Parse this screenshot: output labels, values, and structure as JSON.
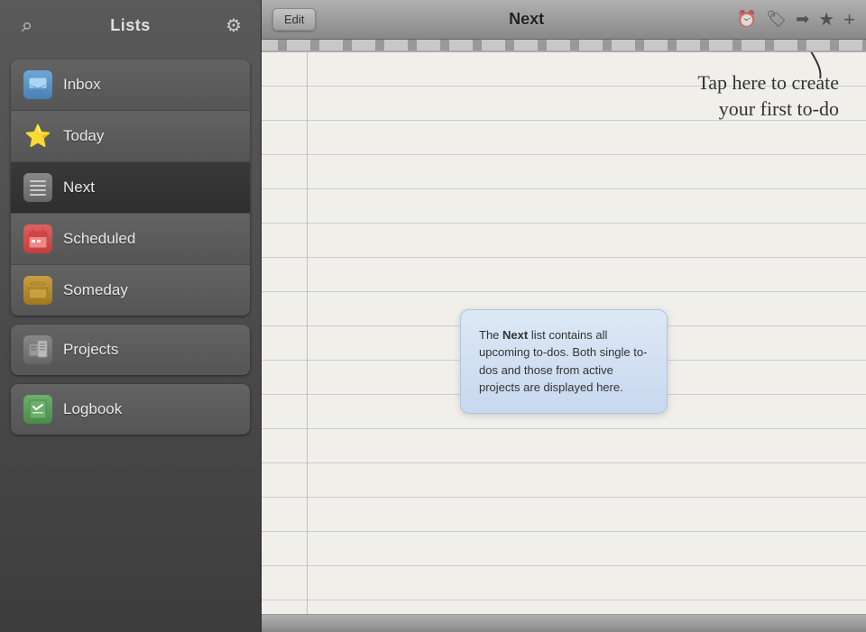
{
  "sidebar": {
    "title": "Lists",
    "search_icon": "⌕",
    "settings_icon": "⚙",
    "groups": [
      {
        "id": "main-list",
        "items": [
          {
            "id": "inbox",
            "label": "Inbox",
            "icon_type": "inbox",
            "icon_char": "📥",
            "active": false
          },
          {
            "id": "today",
            "label": "Today",
            "icon_type": "today",
            "icon_char": "⭐",
            "active": false
          },
          {
            "id": "next",
            "label": "Next",
            "icon_type": "next-icon",
            "icon_char": "≡",
            "active": true
          },
          {
            "id": "scheduled",
            "label": "Scheduled",
            "icon_type": "scheduled",
            "icon_char": "📅",
            "active": false
          },
          {
            "id": "someday",
            "label": "Someday",
            "icon_type": "someday",
            "icon_char": "📦",
            "active": false
          }
        ]
      }
    ],
    "single_groups": [
      {
        "id": "projects-group",
        "items": [
          {
            "id": "projects",
            "label": "Projects",
            "icon_type": "projects",
            "icon_char": "📋",
            "active": false
          }
        ]
      },
      {
        "id": "logbook-group",
        "items": [
          {
            "id": "logbook",
            "label": "Logbook",
            "icon_type": "logbook",
            "icon_char": "✅",
            "active": false
          }
        ]
      }
    ]
  },
  "main": {
    "toolbar": {
      "edit_label": "Edit",
      "title": "Next",
      "icons": {
        "clock": "⏰",
        "tag": "🏷",
        "arrow": "➡",
        "star": "★",
        "plus": "+"
      }
    },
    "tap_hint": {
      "line1": "Tap here to create",
      "line2": "your first to-do"
    },
    "info_box": {
      "prefix": "The ",
      "bold": "Next",
      "suffix": " list contains all upcoming to-dos. Both single to-dos and those from active projects are displayed here."
    }
  }
}
